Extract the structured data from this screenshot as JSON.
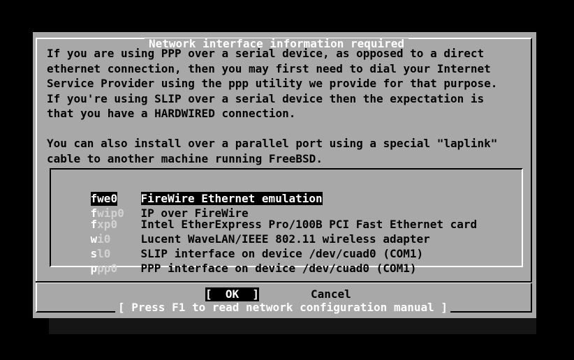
{
  "dialog": {
    "title": "Network interface information required",
    "prompt": "If you are using PPP over a serial device, as opposed to a direct\nethernet connection, then you may first need to dial your Internet\nService Provider using the ppp utility we provide for that purpose.\nIf you're using SLIP over a serial device then the expectation is\nthat you have a HARDWIRED connection.\n\nYou can also install over a parallel port using a special \"laplink\"\ncable to another machine running FreeBSD.",
    "items": [
      {
        "hot": "f",
        "rest": "we0",
        "desc": "FireWire Ethernet emulation",
        "selected": true
      },
      {
        "hot": "f",
        "rest": "wip0",
        "desc": "IP over FireWire",
        "selected": false
      },
      {
        "hot": "f",
        "rest": "xp0",
        "desc": "Intel EtherExpress Pro/100B PCI Fast Ethernet card",
        "selected": false
      },
      {
        "hot": "w",
        "rest": "i0",
        "desc": "Lucent WaveLAN/IEEE 802.11 wireless adapter",
        "selected": false
      },
      {
        "hot": "s",
        "rest": "l0",
        "desc": "SLIP interface on device /dev/cuad0 (COM1)",
        "selected": false
      },
      {
        "hot": "p",
        "rest": "pp0",
        "desc": "PPP interface on device /dev/cuad0 (COM1)",
        "selected": false
      }
    ],
    "ok_label": "[  OK  ]",
    "cancel_label": "Cancel",
    "help_text": "[ Press F1 to read network configuration manual ]"
  },
  "colors": {
    "background": "#000000",
    "dialog": "#a8a8a8",
    "text": "#000000",
    "highlight_text": "#ffffff",
    "hotkey_dim": "#d2d2d2"
  }
}
